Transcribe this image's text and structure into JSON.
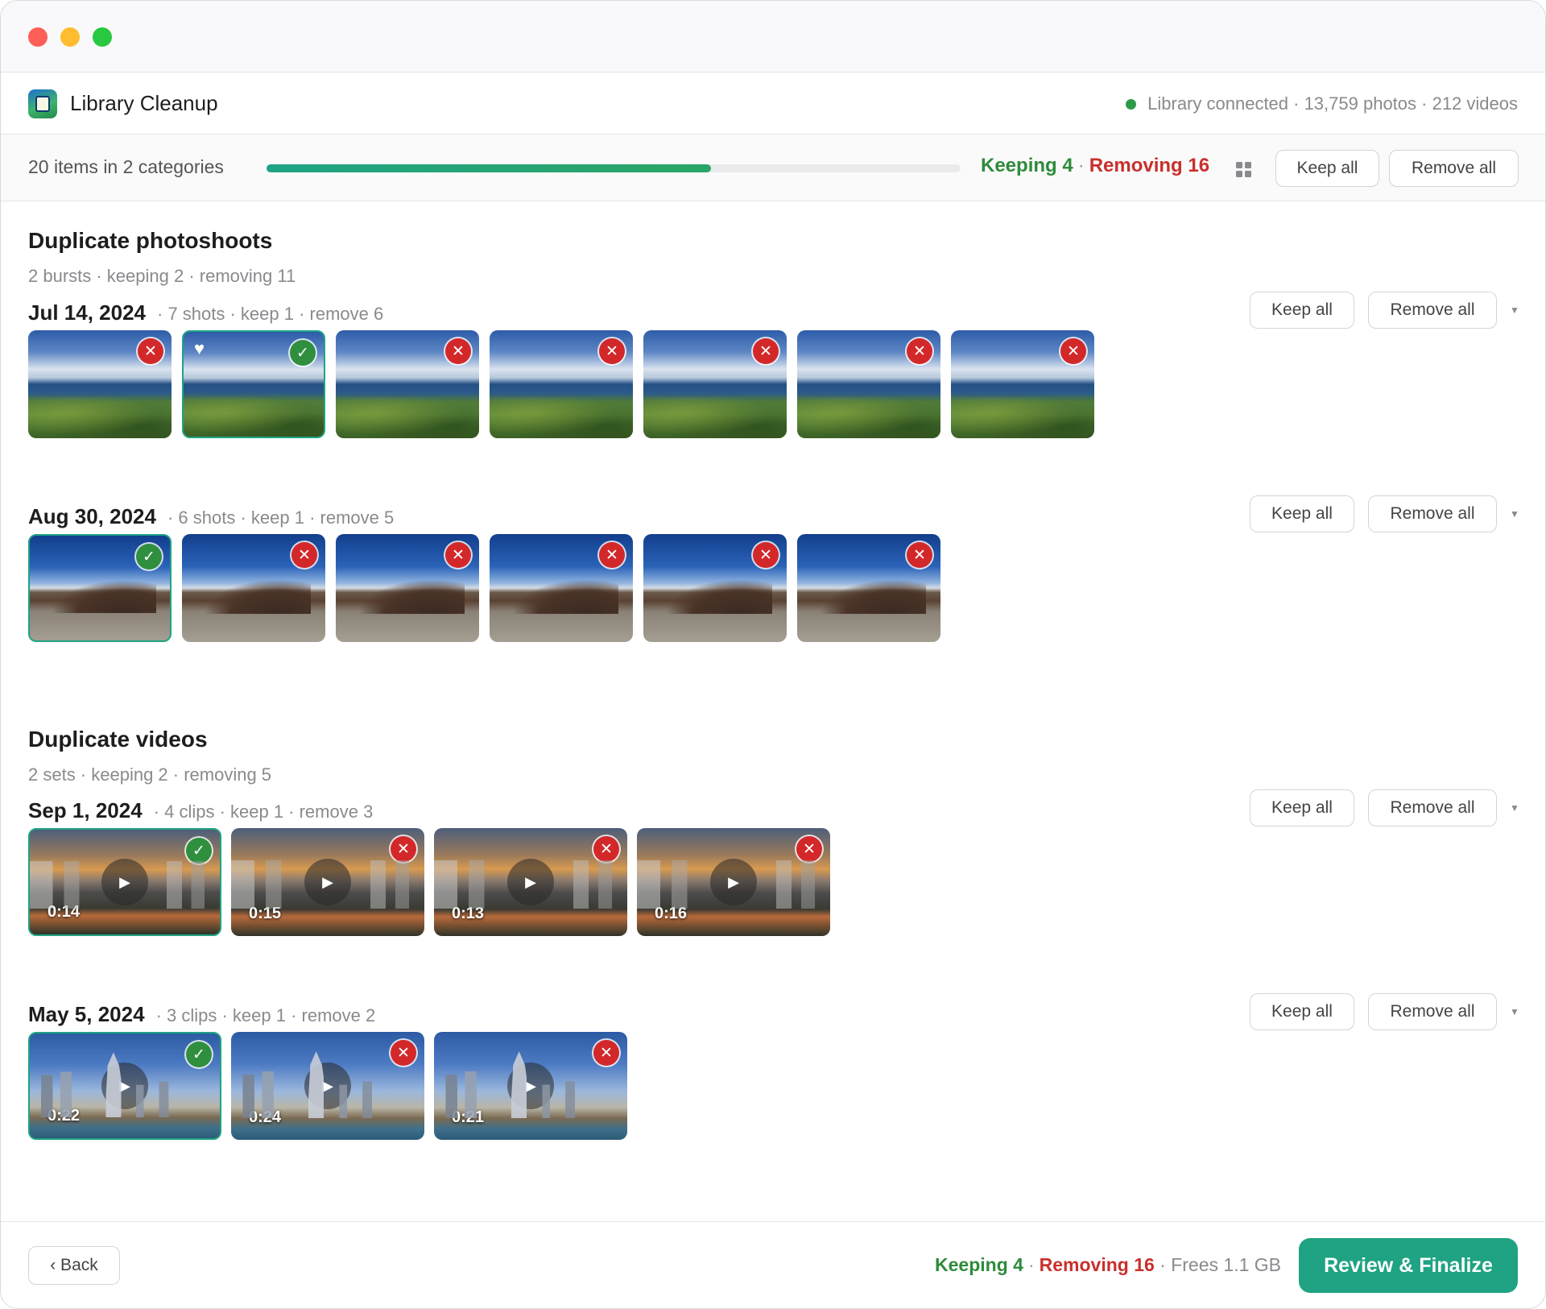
{
  "app": {
    "title": "Library Cleanup",
    "status_text": "Library connected · 13,759 photos · 212 videos",
    "status_color": "#2c9a4a"
  },
  "summary": {
    "count_text": "20 items in 2 categories",
    "progress_fraction": 0.64,
    "keeping": "Keeping 4",
    "removing": "Removing 16",
    "sep": "·",
    "view_icon": "grid-icon",
    "keep_all": "Keep all",
    "remove_all": "Remove all"
  },
  "categories": [
    {
      "title": "Duplicate photoshoots",
      "subtitle": "2 bursts · keeping 2 · removing 11",
      "groups": [
        {
          "date": "Jul 14, 2024",
          "meta": "· 7 shots · keep 1 · remove 6",
          "keep_all": "Keep all",
          "remove_all": "Remove all",
          "scene": "coast",
          "items": [
            {
              "state": "remove"
            },
            {
              "state": "keep",
              "favorite": true
            },
            {
              "state": "remove"
            },
            {
              "state": "remove"
            },
            {
              "state": "remove"
            },
            {
              "state": "remove"
            },
            {
              "state": "remove"
            }
          ]
        },
        {
          "date": "Aug 30, 2024",
          "meta": "· 6 shots · keep 1 · remove 5",
          "keep_all": "Keep all",
          "remove_all": "Remove all",
          "scene": "volcano",
          "items": [
            {
              "state": "keep"
            },
            {
              "state": "remove"
            },
            {
              "state": "remove"
            },
            {
              "state": "remove"
            },
            {
              "state": "remove"
            },
            {
              "state": "remove"
            }
          ]
        }
      ]
    },
    {
      "title": "Duplicate videos",
      "subtitle": "2 sets · keeping 2 · removing 5",
      "groups": [
        {
          "date": "Sep 1, 2024",
          "meta": "· 4 clips · keep 1 · remove 3",
          "keep_all": "Keep all",
          "remove_all": "Remove all",
          "scene": "sunset",
          "items": [
            {
              "state": "keep",
              "duration": "0:14"
            },
            {
              "state": "remove",
              "duration": "0:15"
            },
            {
              "state": "remove",
              "duration": "0:13"
            },
            {
              "state": "remove",
              "duration": "0:16"
            }
          ]
        },
        {
          "date": "May 5, 2024",
          "meta": "· 3 clips · keep 1 · remove 2",
          "keep_all": "Keep all",
          "remove_all": "Remove all",
          "scene": "city",
          "items": [
            {
              "state": "keep",
              "duration": "0:22"
            },
            {
              "state": "remove",
              "duration": "0:24"
            },
            {
              "state": "remove",
              "duration": "0:21"
            }
          ]
        }
      ]
    }
  ],
  "footer": {
    "back": "‹ Back",
    "keeping": "Keeping 4",
    "removing": "Removing 16",
    "sep": "·",
    "frees": "· Frees 1.1 GB",
    "finalize": "Review & Finalize"
  },
  "colors": {
    "accent": "#1fa383",
    "keep": "#2e8b3b",
    "remove": "#c9302c"
  },
  "icons": {
    "remove_badge": "close-icon",
    "keep_badge": "check-icon",
    "favorite": "heart-icon",
    "play": "play-icon",
    "group_menu": "chevron-down-icon"
  }
}
